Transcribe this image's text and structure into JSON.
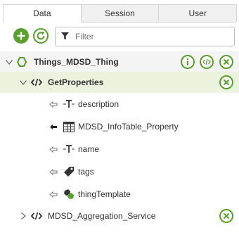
{
  "tabs": [
    {
      "label": "Data"
    },
    {
      "label": "Session"
    },
    {
      "label": "User"
    }
  ],
  "toolbar": {
    "add_icon": "plus-icon",
    "refresh_icon": "refresh-icon",
    "filter_placeholder": "Filter"
  },
  "tree": {
    "root": {
      "label": "Things_MDSD_Thing",
      "icon": "hexagon-icon"
    },
    "service": {
      "label": "GetProperties",
      "icon": "code-icon"
    },
    "properties": [
      {
        "label": "description",
        "type_icon": "string-type-icon",
        "arrow_icon": "outline-arrow-left-icon"
      },
      {
        "label": "MDSD_InfoTable_Property",
        "type_icon": "infotable-type-icon",
        "arrow_icon": "solid-arrow-left-icon"
      },
      {
        "label": "name",
        "type_icon": "string-type-icon",
        "arrow_icon": "outline-arrow-left-icon"
      },
      {
        "label": "tags",
        "type_icon": "tag-type-icon",
        "arrow_icon": "outline-arrow-left-icon"
      },
      {
        "label": "thingTemplate",
        "type_icon": "thingtemplate-type-icon",
        "arrow_icon": "outline-arrow-left-icon"
      }
    ],
    "service2": {
      "label": "MDSD_Aggregation_Service",
      "icon": "code-icon"
    }
  },
  "colors": {
    "accent": "#5aa02c",
    "selected_row": "#ebf3df",
    "root_row": "#f4f4f4"
  }
}
